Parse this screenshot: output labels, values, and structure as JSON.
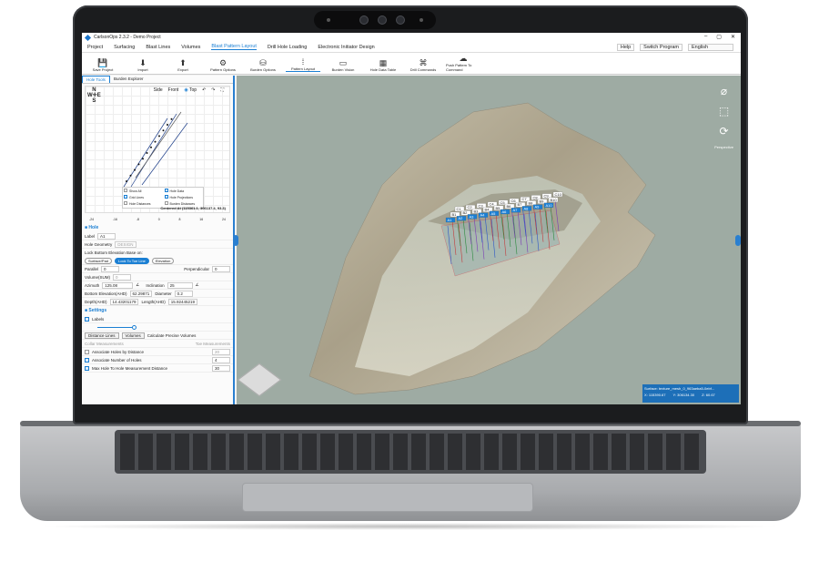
{
  "window": {
    "title": "CarlsonOps 2.3.2 - Demo Project",
    "controls": [
      "–",
      "▢",
      "✕"
    ]
  },
  "menu": {
    "items": [
      "Project",
      "Surfacing",
      "Blast Lines",
      "Volumes",
      "Blast Pattern Layout",
      "Drill Hole Loading",
      "Electronic Initiator Design"
    ],
    "active": "Blast Pattern Layout",
    "help": "Help",
    "switch_program": "Switch Program",
    "language": "English"
  },
  "ribbon": {
    "buttons": [
      {
        "label": "Save Project",
        "icon": "save-icon",
        "glyph": "💾"
      },
      {
        "label": "Import",
        "icon": "import-icon",
        "glyph": "⬇"
      },
      {
        "label": "Export",
        "icon": "export-icon",
        "glyph": "⬆"
      },
      {
        "label": "Pattern Options",
        "icon": "pattern-options-icon",
        "glyph": "⚙"
      },
      {
        "label": "Burden Options",
        "icon": "burden-options-icon",
        "glyph": "⛁"
      },
      {
        "label": "Pattern Layout",
        "icon": "pattern-layout-icon",
        "glyph": "⁞"
      },
      {
        "label": "Burden Vision",
        "icon": "burden-vision-icon",
        "glyph": "▭"
      },
      {
        "label": "Hole Data Table",
        "icon": "table-icon",
        "glyph": "▦"
      },
      {
        "label": "Drill Commands",
        "icon": "command-icon",
        "glyph": "⌘"
      },
      {
        "label": "Push Pattern To Command",
        "icon": "cloud-upload-icon",
        "glyph": "☁"
      }
    ]
  },
  "left_panel": {
    "tabs": [
      "Hole Tools",
      "Burden Explorer"
    ],
    "active_tab": "Hole Tools",
    "view": {
      "side": "Side",
      "front": "Front",
      "top": "Top",
      "selected": "Top"
    },
    "compass": {
      "n": "N",
      "w": "W",
      "e": "E",
      "s": "S"
    },
    "plot_checkboxes": [
      "Show All",
      "Hole Data",
      "Grid Lines",
      "Hole Projections",
      "Hole Distances",
      "Burden Distances"
    ],
    "centered_at": "Centered At (115361.1, 306137.4, 93.3)",
    "x_ticks": [
      "-24",
      "-16",
      "-8",
      "0",
      "8",
      "16",
      "24"
    ],
    "hole": {
      "section": "Hole",
      "label_lbl": "Label",
      "label_val": "A1",
      "geometry_lbl": "Hole Geometry",
      "geometry_val": "DESIGN",
      "lock_lbl": "Lock Bottom Elevation Base on:",
      "lock_opts": [
        "Surface/Pad",
        "Lock To Toe Line",
        "Elevation"
      ],
      "parallel_lbl": "Parallel",
      "parallel_val": "0",
      "perp_lbl": "Perpendicular",
      "perp_val": "0",
      "volume_lbl": "Volume(SUM)",
      "volume_val": "0",
      "azimuth_lbl": "Azimuth",
      "azimuth_val": "125.08",
      "inclination_lbl": "Inclination",
      "inclination_val": "25",
      "bottom_lbl": "Bottom Elevation(AHD)",
      "bottom_val": "62.29871",
      "diameter_lbl": "Diameter",
      "diameter_val": "0.2",
      "depth_lbl": "Depth(AHD)",
      "depth_val": "14.43201179",
      "length_lbl": "Length(AHD)",
      "length_val": "15.92445219"
    },
    "settings": {
      "section": "Settings",
      "labels": "Labels",
      "distance_lines": "Distance Lines",
      "volumes": "Volumes",
      "calc_volumes": "Calculate Precise Volumes",
      "collar_meas": "Collar Measurements",
      "toe_meas": "Toe Measurements",
      "assoc_dist": "Associate Holes by Distance",
      "assoc_dist_val": "20",
      "assoc_num": "Associate Number of Holes",
      "assoc_num_val": "4",
      "max_hole": "Max Hole To Hole Measurement Distance",
      "max_hole_val": "30"
    }
  },
  "viewport": {
    "hole_labels_top": [
      "C1",
      "C2",
      "C3",
      "C4",
      "C5",
      "C6",
      "C7",
      "C8",
      "C9",
      "C10"
    ],
    "hole_labels_mid": [
      "B1",
      "B2",
      "B3",
      "B4",
      "B5",
      "B6",
      "B7",
      "B8",
      "B9",
      "B10"
    ],
    "hole_labels_bot": [
      "A1",
      "A2",
      "A3",
      "A4",
      "A5",
      "A6",
      "A7",
      "A8",
      "A9",
      "A10"
    ],
    "right_tools_label": "Perspective",
    "status": {
      "surface": "Surface: texture_mesh_0_963aeba5-0ebf...",
      "x": "X: 115390.67",
      "y": "Y: 306134.30",
      "z": "Z: 60.67"
    }
  },
  "colors": {
    "accent": "#1b7fd3",
    "viewport_bg": "#9eaba3",
    "status_bg": "#1d6fb8"
  }
}
